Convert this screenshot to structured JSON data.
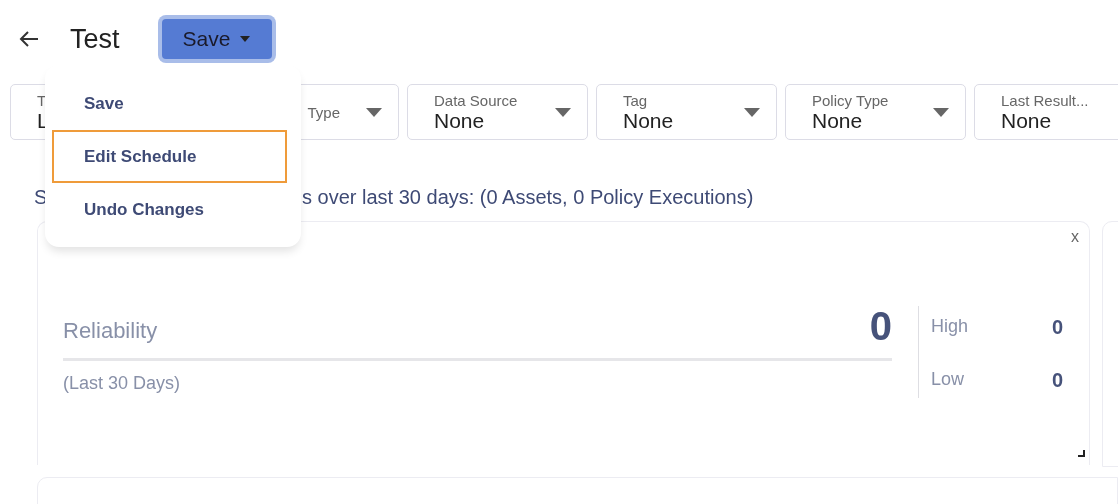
{
  "header": {
    "title": "Test",
    "save_button": {
      "label": "Save",
      "expanded": true
    }
  },
  "menu": [
    {
      "label": "Save",
      "focused": false
    },
    {
      "label": "Edit Schedule",
      "focused": true
    },
    {
      "label": "Undo Changes",
      "focused": false
    }
  ],
  "filters": [
    {
      "label": "T",
      "value": "L"
    },
    {
      "label": "Type"
    },
    {
      "label": "Data Source",
      "value": "None"
    },
    {
      "label": "Tag",
      "value": "None"
    },
    {
      "label": "Policy Type",
      "value": "None"
    },
    {
      "label": "Last Result...",
      "value": "None"
    }
  ],
  "summary": [
    "S",
    "s over last 30 days: (0 Assets, 0 Policy Executions)"
  ],
  "card": {
    "close": "x",
    "metric": "Reliability",
    "value": "0",
    "period": "(Last 30 Days)",
    "breakdown": [
      {
        "label": "High",
        "value": "0"
      },
      {
        "label": "Low",
        "value": "0"
      }
    ]
  }
}
